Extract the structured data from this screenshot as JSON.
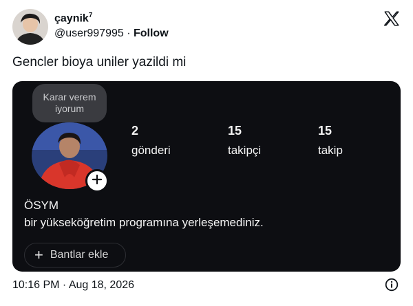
{
  "author": {
    "name": "çaynik",
    "name_sup": "7",
    "handle": "@user997995",
    "separator": " · ",
    "follow_label": "Follow"
  },
  "tweet": {
    "text": "Gencler bioya uniler yazildi mi",
    "timestamp": "10:16 PM · Aug 18, 2026"
  },
  "profile_card": {
    "note": "Karar verem iyorum",
    "stats": [
      {
        "value": "2",
        "label": "gönderi"
      },
      {
        "value": "15",
        "label": "takipçi"
      },
      {
        "value": "15",
        "label": "takip"
      }
    ],
    "bio_name": "ÖSYM",
    "bio_text": "bir yükseköğretim programına yerleşemediniz.",
    "band_button_label": "Bantlar ekle"
  },
  "icons": {
    "x_logo": "x-logo-icon",
    "info": "info-icon",
    "plus": "plus-icon"
  },
  "colors": {
    "card_bg": "#0d0e12",
    "bubble_bg": "#3a3b40",
    "text_dark": "#0f1419"
  }
}
